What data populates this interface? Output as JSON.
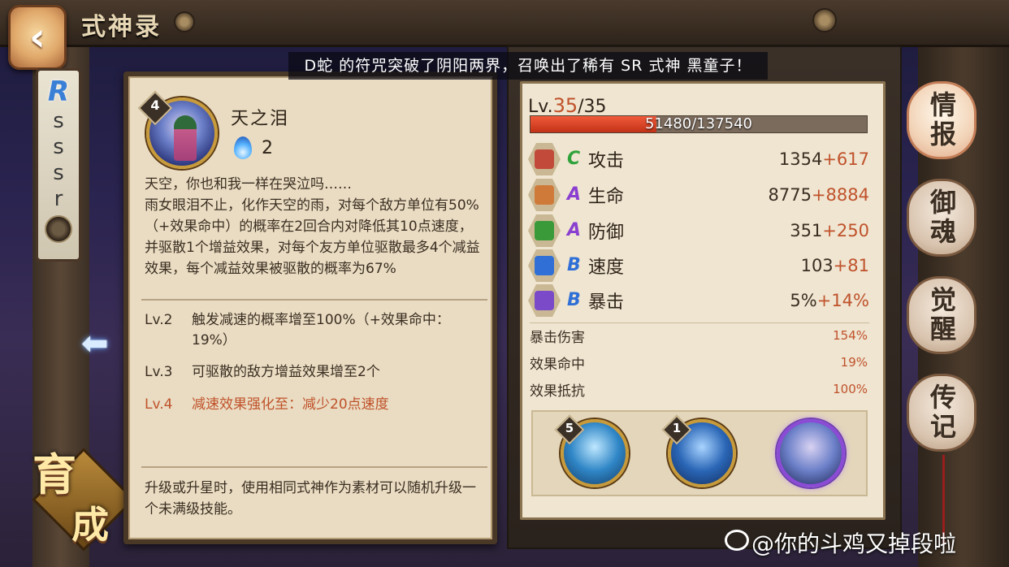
{
  "header": {
    "title": "式神录",
    "back_icon": "‹"
  },
  "rarity_strip": {
    "current": "R",
    "others": [
      "s",
      "s",
      "s",
      "r"
    ]
  },
  "banner": {
    "text": "D蛇 的符咒突破了阴阳两界，召唤出了稀有 SR 式神 黑童子！"
  },
  "skill": {
    "level": "4",
    "name": "天之泪",
    "cost": "2",
    "description": "天空，你也和我一样在哭泣吗……\n雨女眼泪不止，化作天空的雨，对每个敌方单位有50%（+效果命中）的概率在2回合内对降低其10点速度，并驱散1个增益效果，对每个友方单位驱散最多4个减益效果，每个减益效果被驱散的概率为67%",
    "levels": [
      {
        "lv": "Lv.2",
        "text": "触发减速的概率增至100%（+效果命中：19%）",
        "locked": false
      },
      {
        "lv": "Lv.3",
        "text": "可驱散的敌方增益效果增至2个",
        "locked": false
      },
      {
        "lv": "Lv.4",
        "text": "减速效果强化至：减少20点速度",
        "locked": true
      }
    ],
    "footnote": "升级或升星时，使用相同式神作为素材可以随机升级一个未满级技能。"
  },
  "growth_emblem": {
    "char1": "育",
    "char2": "成"
  },
  "stats": {
    "level_prefix": "Lv.",
    "level_current": "35",
    "level_max": "/35",
    "exp_text": "51480/137540",
    "exp_fraction": 0.374,
    "main": [
      {
        "grade": "C",
        "name": "攻击",
        "base": "1354",
        "bonus": "+617",
        "grade_color": "#2fa23a",
        "icon_color": "#c24a3a"
      },
      {
        "grade": "A",
        "name": "生命",
        "base": "8775",
        "bonus": "+8884",
        "grade_color": "#8a3fd0",
        "icon_color": "#d07a3a"
      },
      {
        "grade": "A",
        "name": "防御",
        "base": "351",
        "bonus": "+250",
        "grade_color": "#8a3fd0",
        "icon_color": "#3a9a3a"
      },
      {
        "grade": "B",
        "name": "速度",
        "base": "103",
        "bonus": "+81",
        "grade_color": "#2f6fd6",
        "icon_color": "#2f6fd6"
      },
      {
        "grade": "B",
        "name": "暴击",
        "base": "5%",
        "bonus": "+14%",
        "grade_color": "#2f6fd6",
        "icon_color": "#7a4ac8"
      }
    ],
    "sub": [
      {
        "name": "暴击伤害",
        "value": "154%"
      },
      {
        "name": "效果命中",
        "value": "19%"
      },
      {
        "name": "效果抵抗",
        "value": "100%"
      }
    ]
  },
  "skill_tray": [
    {
      "level": "5",
      "colors": [
        "#bfe8ff",
        "#2f86c6",
        "#143a66"
      ]
    },
    {
      "level": "1",
      "colors": [
        "#a9d4ff",
        "#2a66b6",
        "#122a5a"
      ]
    },
    {
      "level": "",
      "colors": [
        "#d8d2f2",
        "#6b7fc8",
        "#1c2350"
      ],
      "selected": true
    }
  ],
  "tabs": [
    "情报",
    "御魂",
    "觉醒",
    "传记"
  ],
  "watermark": "@你的斗鸡又掉段啦"
}
